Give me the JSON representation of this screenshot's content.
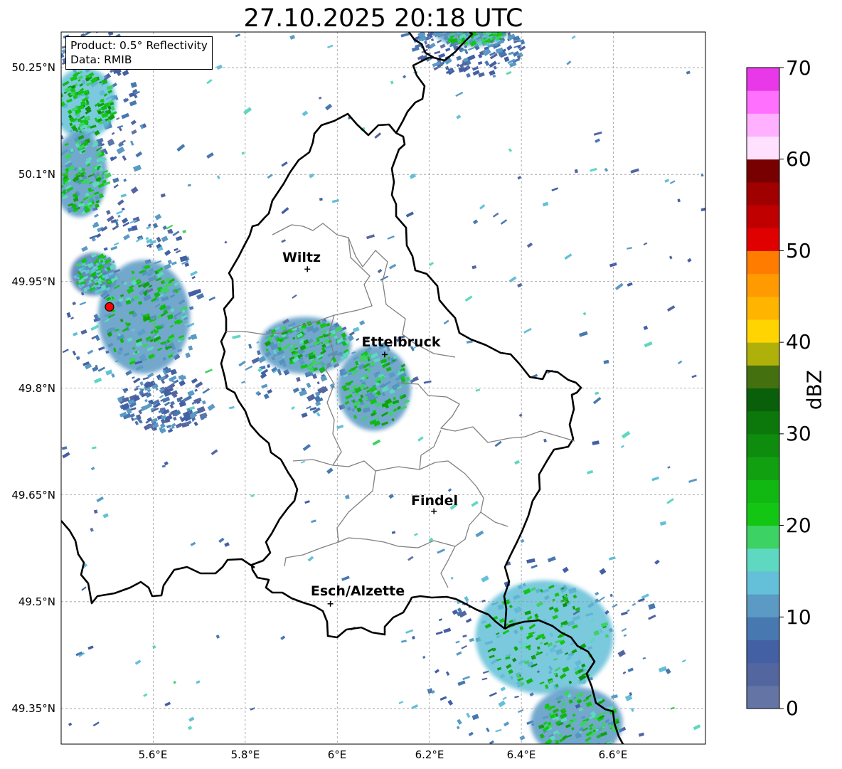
{
  "title": "27.10.2025 20:18 UTC",
  "info": {
    "product_line": "Product: 0.5° Reflectivity",
    "data_line": "Data: RMIB"
  },
  "latitude_labels": [
    "50.25°N",
    "50.1°N",
    "49.95°N",
    "49.8°N",
    "49.65°N",
    "49.5°N",
    "49.35°N"
  ],
  "longitude_labels": [
    "5.6°E",
    "5.8°E",
    "6°E",
    "6.2°E",
    "6.4°E",
    "6.6°E"
  ],
  "extent": {
    "lon_min": 5.4,
    "lon_max": 6.8,
    "lat_min": 49.3,
    "lat_max": 50.3
  },
  "grid_lat": [
    50.25,
    50.1,
    49.95,
    49.8,
    49.65,
    49.5,
    49.35
  ],
  "grid_lon": [
    5.6,
    5.8,
    6.0,
    6.2,
    6.4,
    6.6
  ],
  "cities": [
    {
      "name": "Wiltz",
      "lon": 5.935,
      "lat": 49.967
    },
    {
      "name": "Ettelbruck",
      "lon": 6.103,
      "lat": 49.847
    },
    {
      "name": "Findel",
      "lon": 6.21,
      "lat": 49.627
    },
    {
      "name": "Esch/Alzette",
      "lon": 5.985,
      "lat": 49.497
    }
  ],
  "radar_site": {
    "lon": 5.505,
    "lat": 49.914,
    "color": "#ff0000"
  },
  "colorbar": {
    "label": "dBZ",
    "min": 0,
    "max": 70,
    "tick_labels": [
      "0",
      "10",
      "20",
      "30",
      "40",
      "50",
      "60",
      "70"
    ],
    "colors": [
      "#6474a4",
      "#5466a0",
      "#4460a4",
      "#4878b0",
      "#5a9ac4",
      "#64c0d8",
      "#5ed8c0",
      "#3cd264",
      "#14c614",
      "#12b812",
      "#10a010",
      "#0e8c0e",
      "#0c780c",
      "#0a600a",
      "#447010",
      "#b0b00a",
      "#ffd400",
      "#ffb400",
      "#ff9a00",
      "#ff7c00",
      "#e00000",
      "#c00000",
      "#a00000",
      "#780000",
      "#ffe0ff",
      "#ffb0ff",
      "#ff70ff",
      "#e838e8"
    ]
  },
  "borders": {
    "national_color": "#000000",
    "canton_color": "#808080"
  },
  "reflectivity": {
    "cells": [
      {
        "lon": 5.45,
        "lat": 50.2,
        "rlon": 0.07,
        "rlat": 0.05,
        "dbz": 24
      },
      {
        "lon": 5.44,
        "lat": 50.1,
        "rlon": 0.06,
        "rlat": 0.06,
        "dbz": 22
      },
      {
        "lon": 5.58,
        "lat": 49.9,
        "rlon": 0.1,
        "rlat": 0.08,
        "dbz": 22
      },
      {
        "lon": 5.47,
        "lat": 49.96,
        "rlon": 0.05,
        "rlat": 0.03,
        "dbz": 18
      },
      {
        "lon": 5.93,
        "lat": 49.86,
        "rlon": 0.1,
        "rlat": 0.04,
        "dbz": 22
      },
      {
        "lon": 6.08,
        "lat": 49.8,
        "rlon": 0.08,
        "rlat": 0.06,
        "dbz": 22
      },
      {
        "lon": 6.45,
        "lat": 49.45,
        "rlon": 0.15,
        "rlat": 0.08,
        "dbz": 24
      },
      {
        "lon": 6.52,
        "lat": 49.33,
        "rlon": 0.1,
        "rlat": 0.05,
        "dbz": 22
      },
      {
        "lon": 6.29,
        "lat": 50.3,
        "rlon": 0.08,
        "rlat": 0.02,
        "dbz": 20
      }
    ],
    "light_areas": [
      {
        "lon": 5.47,
        "lat": 50.17,
        "rlon": 0.11,
        "rlat": 0.15,
        "dbz": 6
      },
      {
        "lon": 5.55,
        "lat": 49.92,
        "rlon": 0.15,
        "rlat": 0.13,
        "dbz": 8
      },
      {
        "lon": 5.98,
        "lat": 49.83,
        "rlon": 0.2,
        "rlat": 0.07,
        "dbz": 7
      },
      {
        "lon": 6.45,
        "lat": 49.42,
        "rlon": 0.27,
        "rlat": 0.14,
        "dbz": 8
      },
      {
        "lon": 6.28,
        "lat": 50.28,
        "rlon": 0.12,
        "rlat": 0.04,
        "dbz": 6
      },
      {
        "lon": 5.62,
        "lat": 49.78,
        "rlon": 0.1,
        "rlat": 0.04,
        "dbz": 6
      }
    ]
  }
}
